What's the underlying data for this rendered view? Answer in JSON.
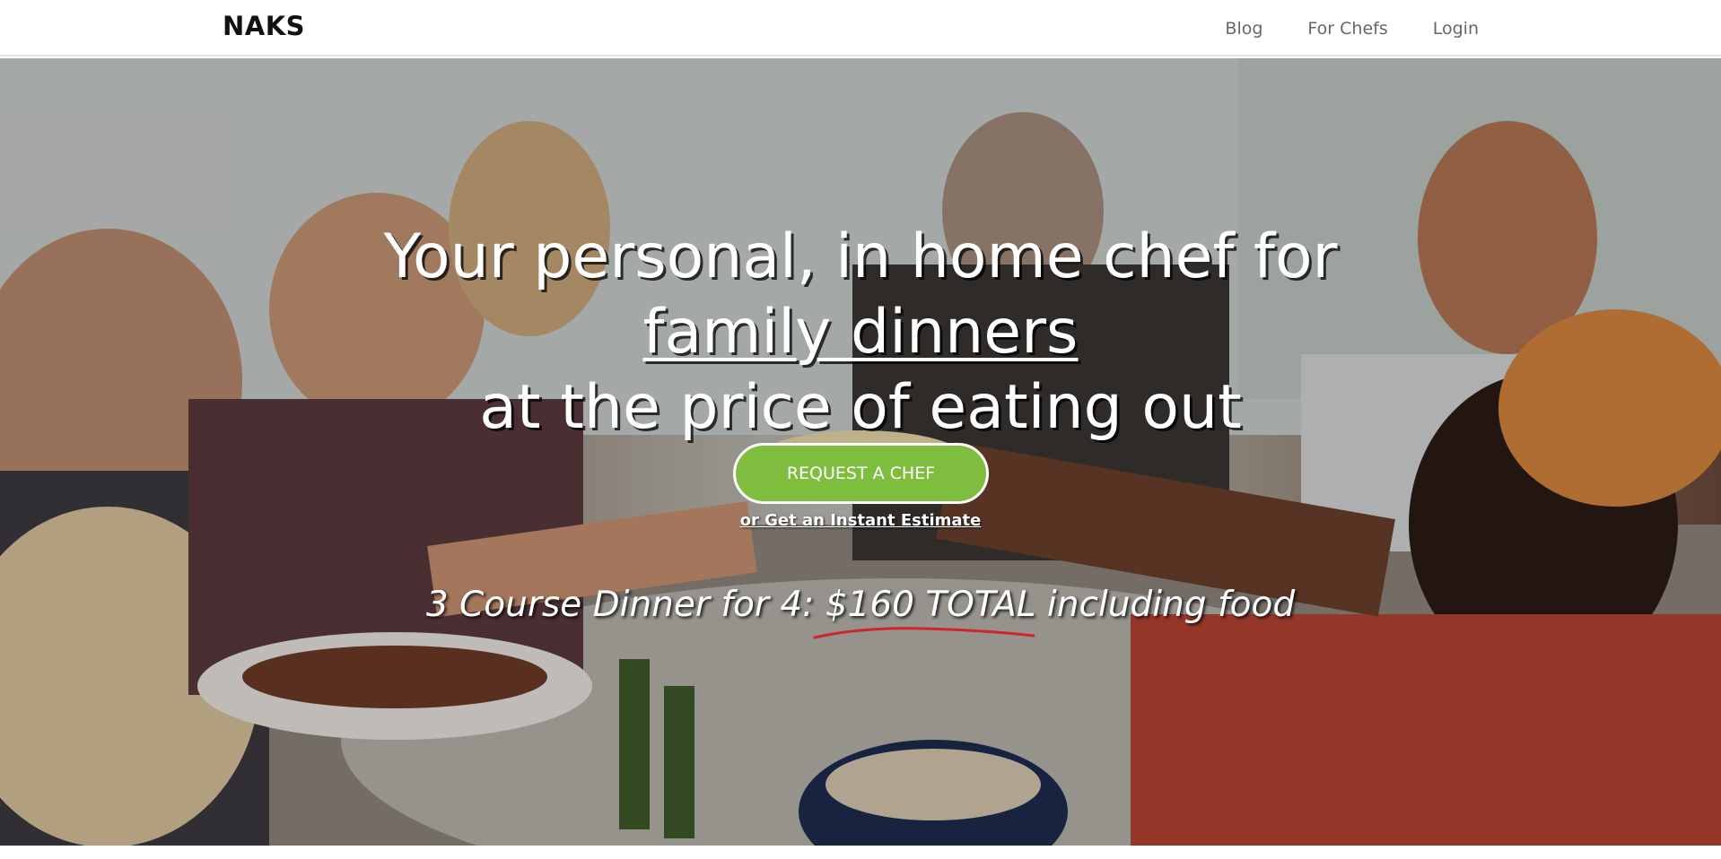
{
  "nav": {
    "brand": "NAKS",
    "links": [
      "Blog",
      "For Chefs",
      "Login"
    ]
  },
  "hero": {
    "headline_line1": "Your personal, in home chef for",
    "headline_line2": "family dinners",
    "headline_line3": "at the price of eating out",
    "cta_label": "REQUEST A CHEF",
    "estimate_link": "or Get an Instant Estimate",
    "price_prefix": "3 Course Dinner for 4: ",
    "price_highlight": "$160 TOTAL",
    "price_suffix": " including food"
  },
  "colors": {
    "cta_green": "#7fbd3f",
    "highlight_underline": "#d0232a"
  }
}
